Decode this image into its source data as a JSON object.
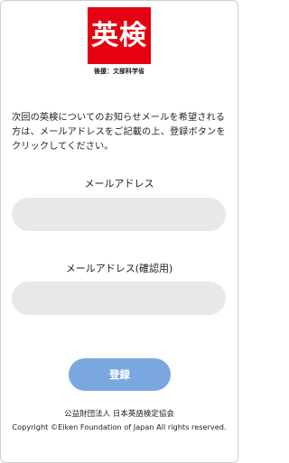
{
  "header": {
    "logo_text": "英検",
    "sponsor": "後援：文部科学省"
  },
  "intro": "次回の英検についてのお知らせメールを希望される方は、メールアドレスをご記載の上、登録ボタンをクリックしてください。",
  "form": {
    "email_label": "メールアドレス",
    "email_value": "",
    "confirm_label": "メールアドレス(確認用)",
    "confirm_value": "",
    "submit_label": "登録"
  },
  "footer": {
    "organization": "公益財団法人 日本英語検定協会",
    "copyright": "Copyright ©Eiken Foundation of Japan All rights reserved."
  },
  "colors": {
    "brand_red": "#e60012",
    "button_blue": "#7aa7e0",
    "field_gray": "#e8e8e8"
  }
}
